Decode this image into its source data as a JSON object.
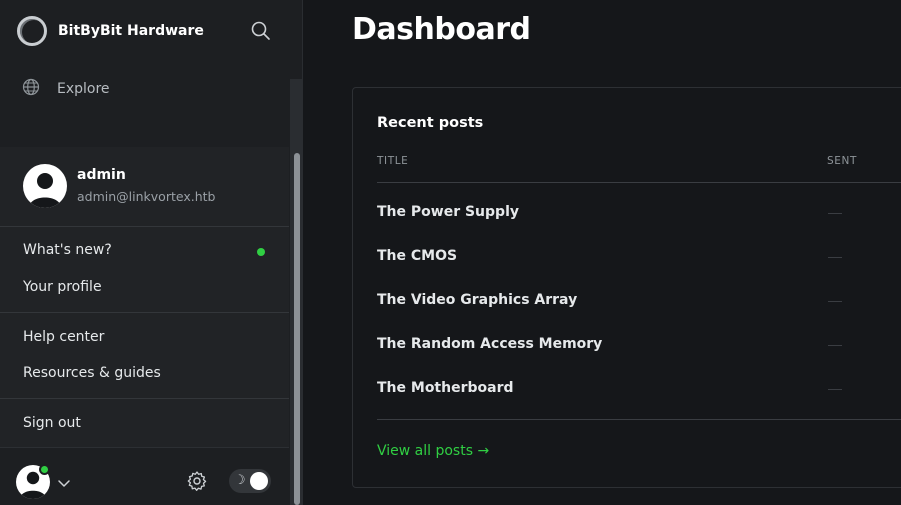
{
  "sidebar": {
    "brand_name": "BitByBit Hardware",
    "nav": {
      "explore_label": "Explore"
    }
  },
  "menu": {
    "user_name": "admin",
    "user_email": "admin@linkvortex.htb",
    "items": [
      {
        "label": "What's new?",
        "badge": "new"
      },
      {
        "label": "Your profile"
      },
      {
        "label": "Help center"
      },
      {
        "label": "Resources & guides"
      },
      {
        "label": "Sign out"
      }
    ]
  },
  "footer": {
    "theme_icon": "☽"
  },
  "main": {
    "title": "Dashboard",
    "recent_posts": {
      "heading": "Recent posts",
      "columns": {
        "title": "TITLE",
        "sent": "SENT"
      },
      "rows": [
        {
          "title": "The Power Supply"
        },
        {
          "title": "The CMOS"
        },
        {
          "title": "The Video Graphics Array"
        },
        {
          "title": "The Random Access Memory"
        },
        {
          "title": "The Motherboard"
        }
      ],
      "view_all": "View all posts →"
    }
  },
  "colors": {
    "accent_green": "#30cf43",
    "background": "#15171a",
    "sidebar": "#1d1f22"
  }
}
